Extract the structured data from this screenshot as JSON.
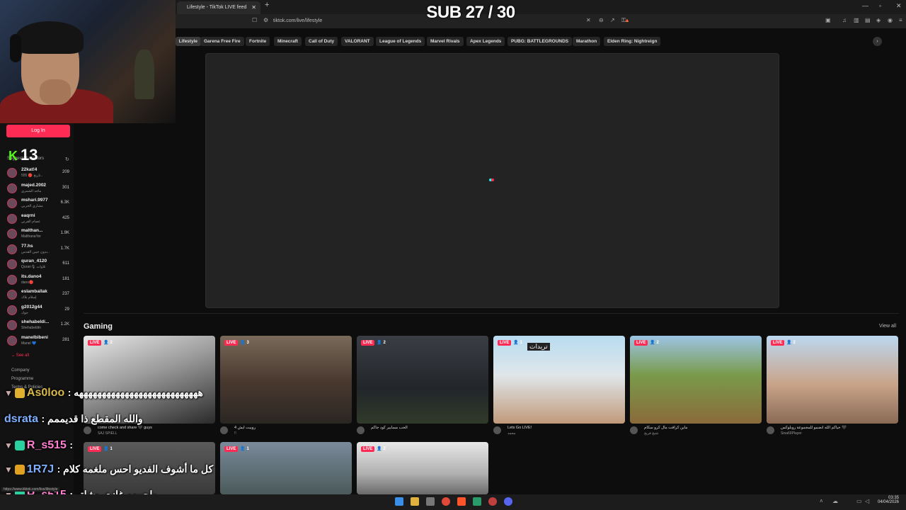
{
  "banner": {
    "text": "SUB 27 / 30"
  },
  "browser": {
    "tab_title": "Lifestyle - TikTok LIVE feed",
    "address": "tiktok.com/live/lifestyle",
    "status_url": "https://www.tiktok.com/live/lifestyle"
  },
  "sidebar": {
    "login_label": "Log In",
    "kick_count": "13",
    "suggested_label": "Suggested creators",
    "creators": [
      {
        "name": "22kat!4",
        "sub": "555 🔴 تاريخ..",
        "count": "209"
      },
      {
        "name": "majed.2002",
        "sub": "ماجد الشمري",
        "count": "301"
      },
      {
        "name": "mshari.9977",
        "sub": "مشاري الحربي",
        "count": "6.3K"
      },
      {
        "name": "eaqrni",
        "sub": "عصام القرني",
        "count": "425"
      },
      {
        "name": "malthan...",
        "sub": "MalthanaYer",
        "count": "1.9K"
      },
      {
        "name": "77.hs",
        "sub": "بدون جبين القدس..",
        "count": "1.7K"
      },
      {
        "name": "quran_4120",
        "sub": "Quran🎙 تلاوات",
        "count": "611"
      },
      {
        "name": "its.dano4",
        "sub": "dano🔴",
        "count": "181"
      },
      {
        "name": "eslamballak",
        "sub": "إسلام بلاك",
        "count": "237"
      },
      {
        "name": "g2012g44",
        "sub": "جوك",
        "count": "29"
      },
      {
        "name": "shehabeldi...",
        "sub": "Shehabeldin",
        "count": "1.2K"
      },
      {
        "name": "manelbibeni",
        "sub": "Manel 💙",
        "count": "281"
      }
    ],
    "see_all": "See all",
    "footer": [
      "Company",
      "Programme",
      "Terms & Policies"
    ]
  },
  "categories": [
    "Lifestyle",
    "Garena Free Fire",
    "Fortnite",
    "Minecraft",
    "Call of Duty",
    "VALORANT",
    "League of Legends",
    "Marvel Rivals",
    "Apex Legends",
    "PUBG: BATTLEGROUNDS",
    "Marathon",
    "Elden Ring: Nightreign"
  ],
  "section": {
    "title": "Gaming",
    "view_all": "View all"
  },
  "cards": [
    {
      "live": "LIVE",
      "viewers": "2",
      "title": "come check and share 🖤 guys",
      "user": "SAJ SPIELL"
    },
    {
      "live": "LIVE",
      "viewers": "3",
      "title": "4 روبيت ايش",
      "user": "!!"
    },
    {
      "live": "LIVE",
      "viewers": "2",
      "title": "الحب مسايير كود جاكم",
      "user": ""
    },
    {
      "live": "LIVE",
      "viewers": "1",
      "title": "Lets Go LIVE!",
      "user": "محمد"
    },
    {
      "live": "LIVE",
      "viewers": "2",
      "title": "ماين كرافت مال كرو سكام",
      "user": "شيخ فريح"
    },
    {
      "live": "LIVE",
      "viewers": "2",
      "title": "حياكم الله انضمو للمجموعة روبلوكس 🖤",
      "user": "Sina69Player"
    },
    {
      "live": "LIVE",
      "viewers": "1",
      "title": "",
      "user": ""
    },
    {
      "live": "LIVE",
      "viewers": "1",
      "title": "",
      "user": ""
    },
    {
      "live": "LIVE",
      "viewers": "2",
      "title": "",
      "user": ""
    }
  ],
  "card_overlay_text": "تريدات",
  "chat": [
    {
      "user": "As0loo",
      "color": "#d9b84a",
      "msg": ": هههههههههههههههههههههههههههه"
    },
    {
      "user": "dsrata",
      "color": "#7fb0ff",
      "msg": ": والله المقطع ذا قديممم"
    },
    {
      "user": "R_s515",
      "color": "#ff7fd0",
      "msg": ":"
    },
    {
      "user": "1R7J",
      "color": "#7fb0ff",
      "msg": ": كل ما أشوف الفديو احس ملغمه كلام"
    },
    {
      "user": "R_s515",
      "color": "#ff7fd0",
      "msg": ": ماحبيهم غازي وشلتو"
    }
  ],
  "taskbar": {
    "time": "03:35",
    "date": "04/04/2026"
  }
}
